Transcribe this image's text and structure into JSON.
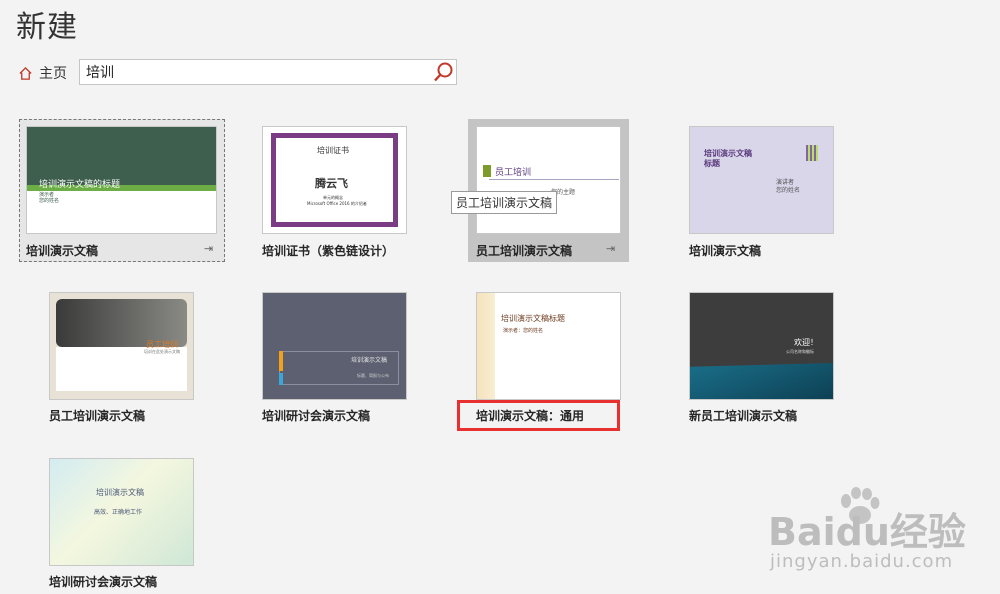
{
  "page": {
    "title": "新建"
  },
  "nav": {
    "home_label": "主页"
  },
  "search": {
    "value": "培训"
  },
  "tooltip": "员工培训演示文稿",
  "templates": [
    {
      "label": "培训演示文稿",
      "thumb_title": "培训演示文稿的标题",
      "thumb_sub1": "演示者",
      "thumb_sub2": "您的姓名"
    },
    {
      "label": "培训证书（紫色链设计）",
      "thumb_title": "培训证书",
      "thumb_name": "腾云飞",
      "thumb_sub1": "单元的概念",
      "thumb_sub2": "Microsoft Office 2016 的介绍者"
    },
    {
      "label": "员工培训演示文稿",
      "thumb_title": "员工培训",
      "thumb_sub1": "您的主题"
    },
    {
      "label": "培训演示文稿",
      "thumb_title": "培训演示文稿\n标题",
      "thumb_sub1": "演讲者",
      "thumb_sub2": "您的姓名"
    },
    {
      "label": "员工培训演示文稿",
      "thumb_title": "员工培训",
      "thumb_sub1": "培训在此处演示文稿"
    },
    {
      "label": "培训研讨会演示文稿",
      "thumb_title": "培训演示文稿",
      "thumb_sub1": "标题、简报与公布"
    },
    {
      "label": "培训演示文稿：通用",
      "thumb_title": "培训演示文稿标题",
      "thumb_sub1": "演示者：您的姓名"
    },
    {
      "label": "新员工培训演示文稿",
      "thumb_title": "欢迎！",
      "thumb_sub1": "公司名称和徽标"
    },
    {
      "label": "培训研讨会演示文稿",
      "thumb_title": "培训演示文稿",
      "thumb_sub1": "高效、正确地工作"
    }
  ],
  "watermark": {
    "logo": "Baidu经验",
    "url": "jingyan.baidu.com"
  },
  "colors": {
    "highlight": "#e8312f",
    "search_icon": "#c0392b"
  }
}
